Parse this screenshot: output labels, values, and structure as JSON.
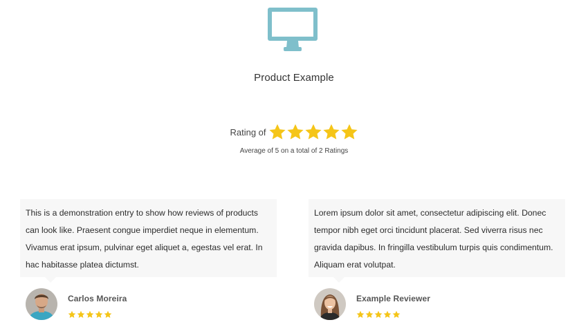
{
  "product": {
    "icon": "monitor-icon",
    "title": "Product Example",
    "icon_color": "#7fbfcb"
  },
  "rating": {
    "label": "Rating of",
    "stars": 5,
    "max_stars": 5,
    "star_color": "#f5c518",
    "average_text": "Average of 5 on a total of 2 Ratings"
  },
  "reviews": [
    {
      "text": "This is a demonstration entry to show how reviews of products can look like. Praesent congue imperdiet neque in elementum. Vivamus erat ipsum, pulvinar eget aliquet a, egestas vel erat. In hac habitasse platea dictumst.",
      "reviewer": "Carlos Moreira",
      "stars": 5
    },
    {
      "text": "Lorem ipsum dolor sit amet, consectetur adipiscing elit. Donec tempor nibh eget orci tincidunt placerat. Sed viverra risus nec gravida dapibus. In fringilla vestibulum turpis quis condimentum. Aliquam erat volutpat.",
      "reviewer": "Example Reviewer",
      "stars": 5
    }
  ]
}
